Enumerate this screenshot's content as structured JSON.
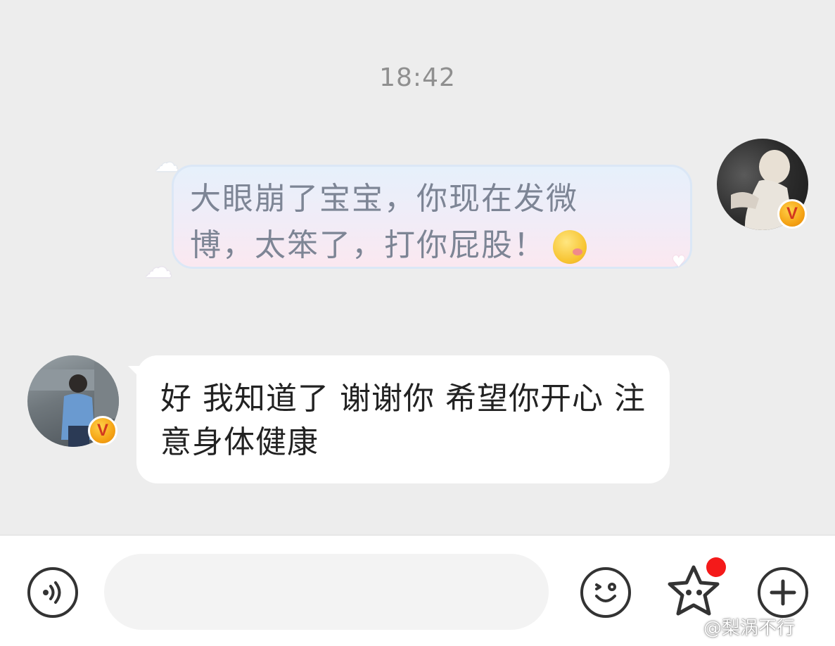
{
  "chat": {
    "timestamp": "18:42",
    "messages": [
      {
        "direction": "outgoing",
        "text": "大眼崩了宝宝，你现在发微博，太笨了，打你屁股！",
        "emoji": "blushing-face-emoji"
      },
      {
        "direction": "incoming",
        "text": "好 我知道了 谢谢你 希望你开心 注意身体健康"
      }
    ]
  },
  "avatars": {
    "self_badge": "V",
    "other_badge": "V"
  },
  "input_bar": {
    "voice_icon": "voice-icon",
    "input_value": "",
    "emoji_icon": "smiley-icon",
    "star_icon": "star-face-icon",
    "plus_icon": "plus-icon"
  },
  "watermark": "@梨涡不行",
  "colors": {
    "background": "#ededed",
    "incoming_bubble": "#ffffff",
    "outgoing_text": "#7d8595",
    "notification_dot": "#f41a1a",
    "badge_gold": "#f5a315"
  }
}
